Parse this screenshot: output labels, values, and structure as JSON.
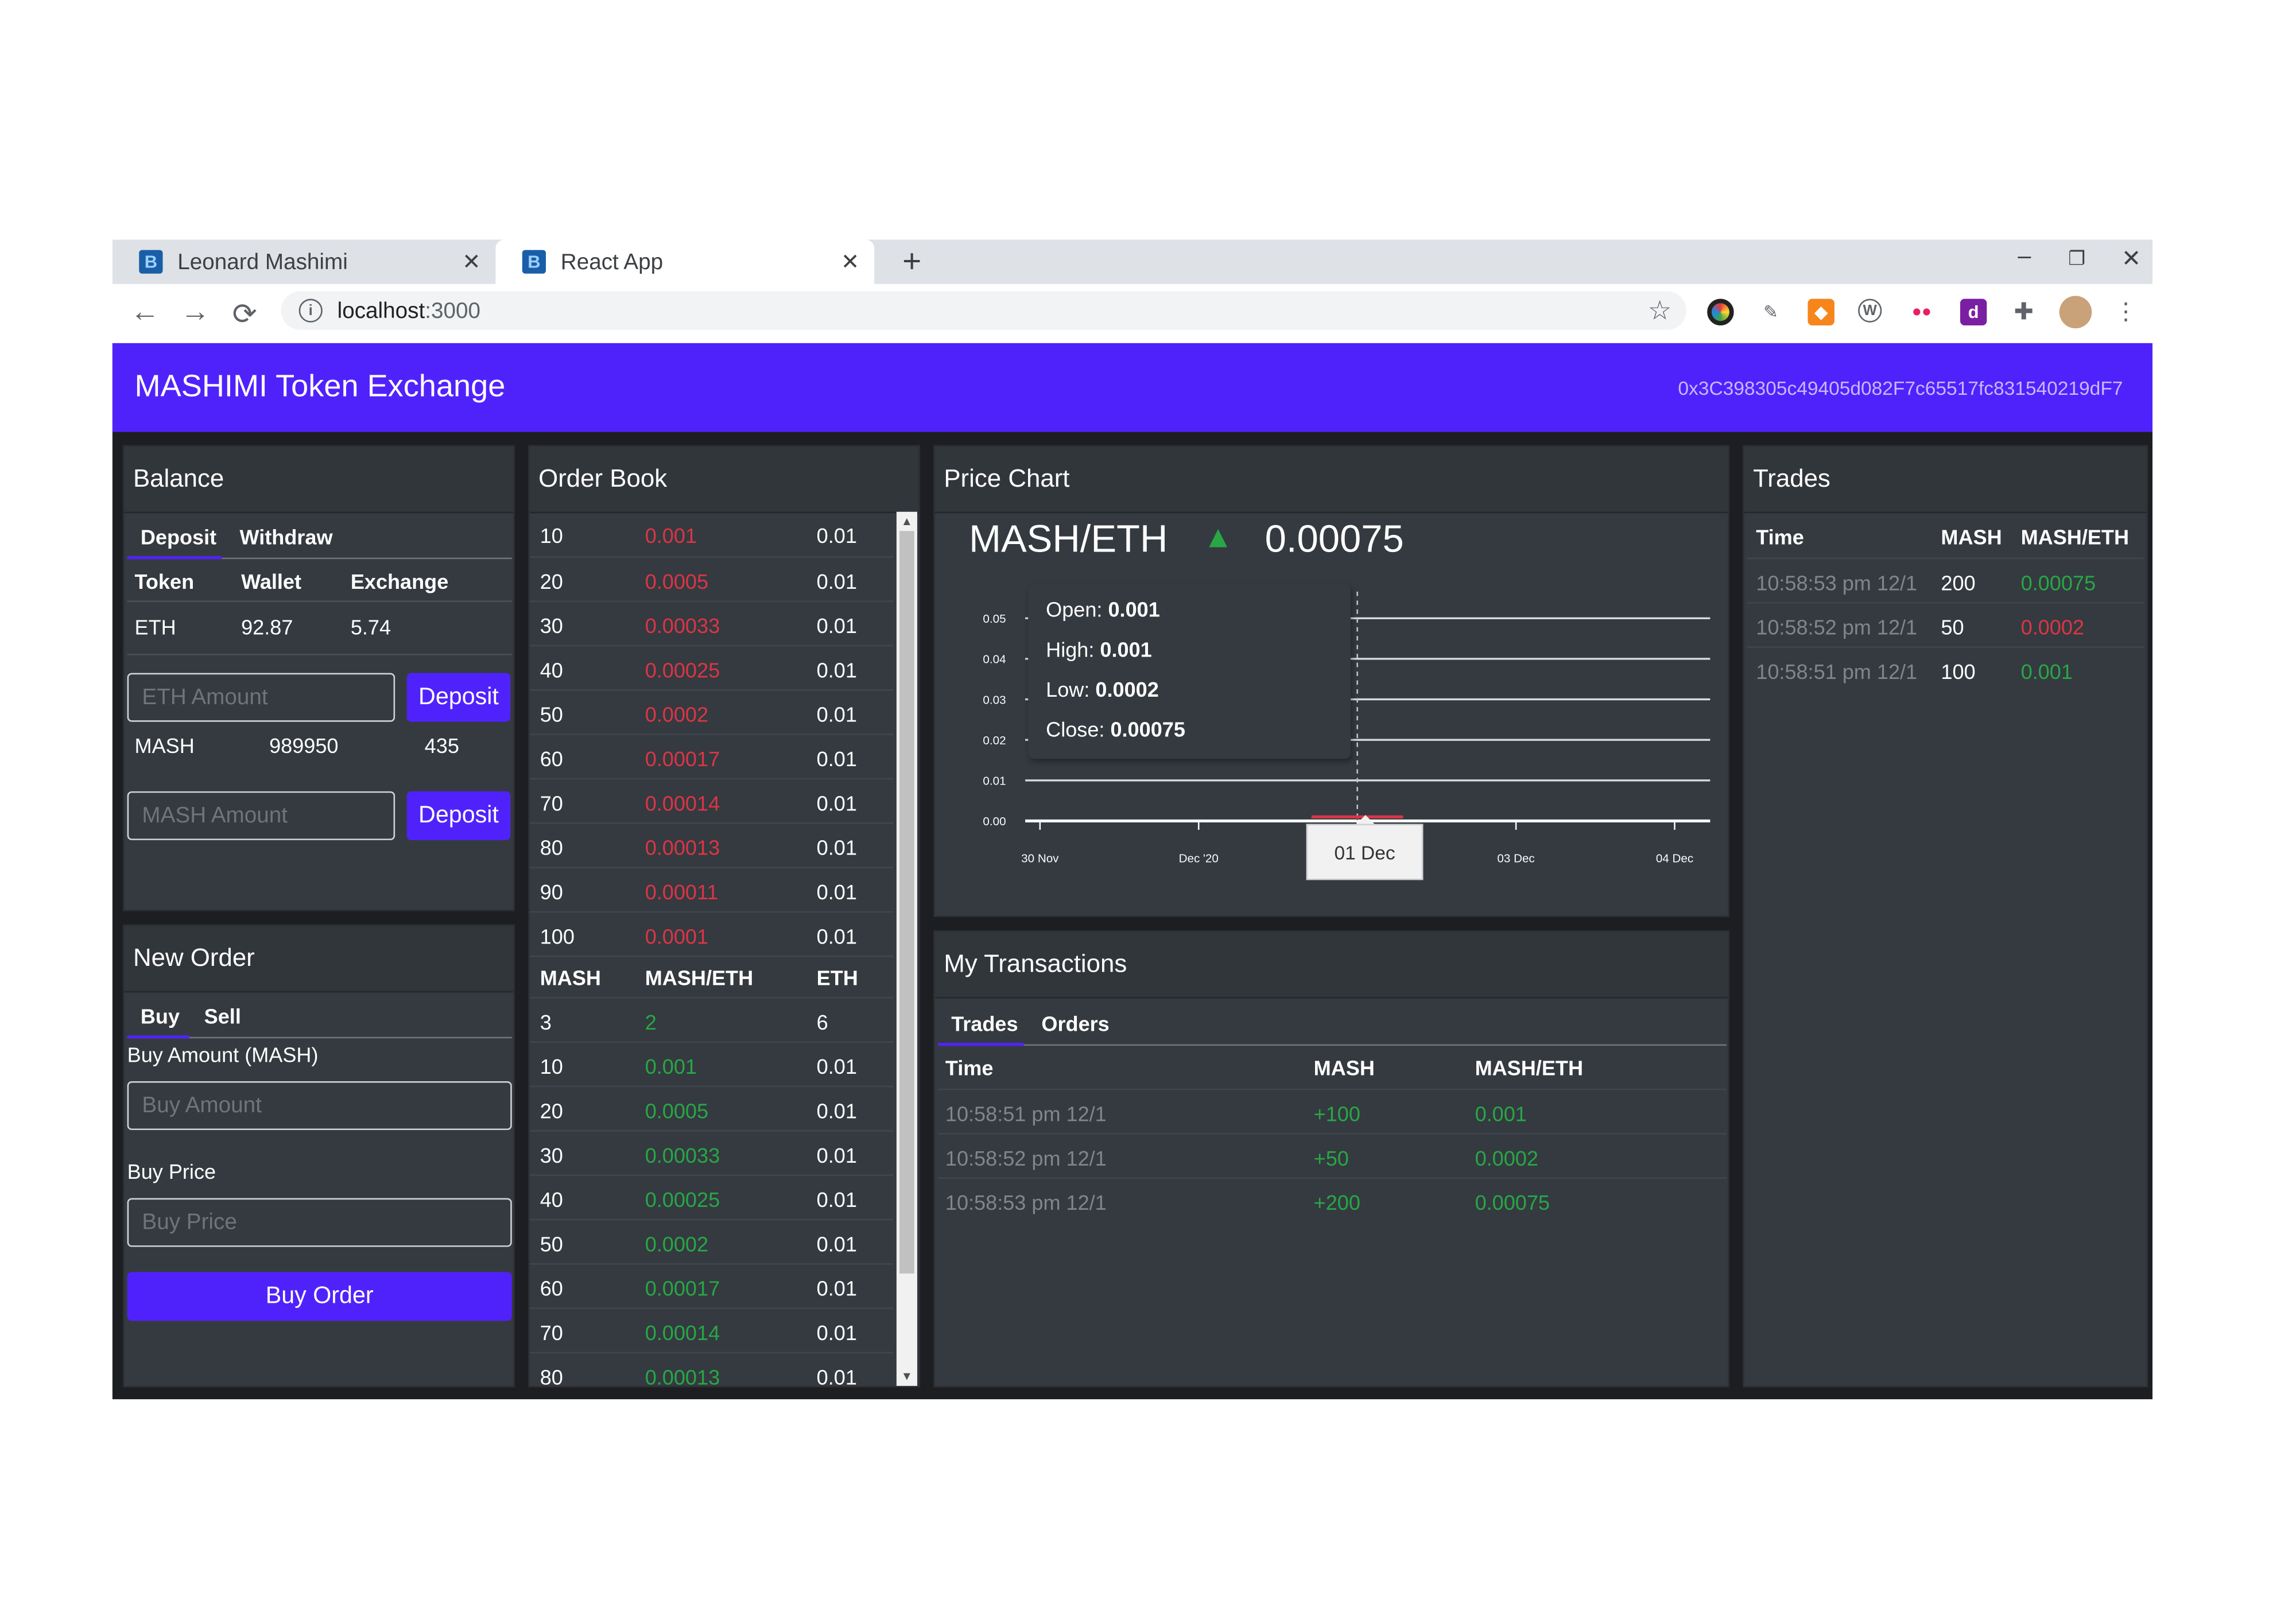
{
  "browser": {
    "tabs": [
      {
        "label": "Leonard Mashimi",
        "favicon": "B"
      },
      {
        "label": "React App",
        "favicon": "B"
      }
    ],
    "url_host": "localhost",
    "url_port": ":3000"
  },
  "header": {
    "title": "MASHIMI Token Exchange",
    "account": "0x3C398305c49405d082F7c65517fc831540219dF7"
  },
  "balance": {
    "title": "Balance",
    "tabs": [
      "Deposit",
      "Withdraw"
    ],
    "columns": [
      "Token",
      "Wallet",
      "Exchange"
    ],
    "eth": {
      "token": "ETH",
      "wallet": "92.87",
      "exchange": "5.74"
    },
    "eth_placeholder": "ETH Amount",
    "deposit_label": "Deposit",
    "mash": {
      "token": "MASH",
      "wallet": "989950",
      "exchange": "435"
    },
    "mash_placeholder": "MASH Amount"
  },
  "new_order": {
    "title": "New Order",
    "tabs": [
      "Buy",
      "Sell"
    ],
    "amount_label": "Buy Amount (MASH)",
    "amount_placeholder": "Buy Amount",
    "price_label": "Buy Price",
    "price_placeholder": "Buy Price",
    "submit_label": "Buy Order"
  },
  "order_book": {
    "title": "Order Book",
    "columns": [
      "MASH",
      "MASH/ETH",
      "ETH"
    ],
    "sell_orders": [
      [
        "10",
        "0.001",
        "0.01"
      ],
      [
        "20",
        "0.0005",
        "0.01"
      ],
      [
        "30",
        "0.00033",
        "0.01"
      ],
      [
        "40",
        "0.00025",
        "0.01"
      ],
      [
        "50",
        "0.0002",
        "0.01"
      ],
      [
        "60",
        "0.00017",
        "0.01"
      ],
      [
        "70",
        "0.00014",
        "0.01"
      ],
      [
        "80",
        "0.00013",
        "0.01"
      ],
      [
        "90",
        "0.00011",
        "0.01"
      ],
      [
        "100",
        "0.0001",
        "0.01"
      ]
    ],
    "buy_orders": [
      [
        "3",
        "2",
        "6"
      ],
      [
        "10",
        "0.001",
        "0.01"
      ],
      [
        "20",
        "0.0005",
        "0.01"
      ],
      [
        "30",
        "0.00033",
        "0.01"
      ],
      [
        "40",
        "0.00025",
        "0.01"
      ],
      [
        "50",
        "0.0002",
        "0.01"
      ],
      [
        "60",
        "0.00017",
        "0.01"
      ],
      [
        "70",
        "0.00014",
        "0.01"
      ],
      [
        "80",
        "0.00013",
        "0.01"
      ]
    ]
  },
  "price_chart": {
    "title": "Price Chart",
    "pair": "MASH/ETH",
    "trend": "up",
    "last_price": "0.00075",
    "tooltip": {
      "open_label": "Open: ",
      "open": "0.001",
      "high_label": "High: ",
      "high": "0.001",
      "low_label": "Low: ",
      "low": "0.0002",
      "close_label": "Close: ",
      "close": "0.00075"
    },
    "crosshair_label": "01 Dec"
  },
  "chart_data": {
    "type": "candlestick",
    "title": "",
    "x_ticks": [
      "30 Nov",
      "Dec '20",
      "01 Dec",
      "03 Dec",
      "04 Dec"
    ],
    "y_ticks": [
      "0.05",
      "0.04",
      "0.03",
      "0.02",
      "0.01",
      "0.00"
    ],
    "ylim": [
      0,
      0.05
    ],
    "grid": true,
    "series": [
      {
        "x": "01 Dec",
        "open": 0.001,
        "high": 0.001,
        "low": 0.0002,
        "close": 0.00075
      }
    ],
    "candle_color": "#dc3545"
  },
  "my_transactions": {
    "title": "My Transactions",
    "tabs": [
      "Trades",
      "Orders"
    ],
    "columns": [
      "Time",
      "MASH",
      "MASH/ETH"
    ],
    "rows": [
      [
        "10:58:51 pm 12/1",
        "+100",
        "0.001"
      ],
      [
        "10:58:52 pm 12/1",
        "+50",
        "0.0002"
      ],
      [
        "10:58:53 pm 12/1",
        "+200",
        "0.00075"
      ]
    ]
  },
  "trades": {
    "title": "Trades",
    "columns": [
      "Time",
      "MASH",
      "MASH/ETH"
    ],
    "rows": [
      {
        "time": "10:58:53 pm 12/1",
        "mash": "200",
        "price": "0.00075",
        "side": "buy"
      },
      {
        "time": "10:58:52 pm 12/1",
        "mash": "50",
        "price": "0.0002",
        "side": "sell"
      },
      {
        "time": "10:58:51 pm 12/1",
        "mash": "100",
        "price": "0.001",
        "side": "buy"
      }
    ]
  },
  "colors": {
    "accent": "#5022fb",
    "panel": "#343a40",
    "background": "#1d1e21",
    "buy": "#28a745",
    "sell": "#dc3545"
  }
}
